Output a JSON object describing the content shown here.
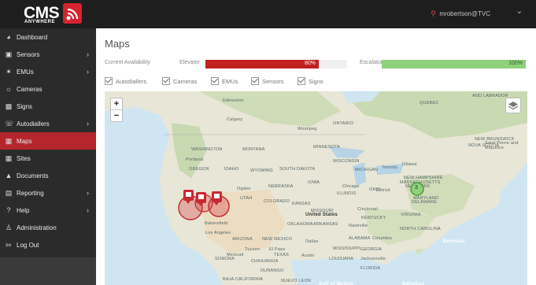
{
  "header": {
    "logo_text": "CMS",
    "logo_subtext": "ANYWHERE",
    "username": "mrobertson@TVC"
  },
  "sidebar": {
    "items": [
      {
        "label": "Dashboard",
        "icon": "dashboard-icon",
        "has_submenu": false
      },
      {
        "label": "Sensors",
        "icon": "sensor-icon",
        "has_submenu": true
      },
      {
        "label": "EMUs",
        "icon": "emu-icon",
        "has_submenu": true
      },
      {
        "label": "Cameras",
        "icon": "camera-icon",
        "has_submenu": false
      },
      {
        "label": "Signs",
        "icon": "sign-icon",
        "has_submenu": false
      },
      {
        "label": "Autodiallers",
        "icon": "autodialler-icon",
        "has_submenu": true
      },
      {
        "label": "Maps",
        "icon": "map-icon",
        "has_submenu": false,
        "active": true
      },
      {
        "label": "Sites",
        "icon": "sites-icon",
        "has_submenu": false
      },
      {
        "label": "Documents",
        "icon": "folder-icon",
        "has_submenu": false
      },
      {
        "label": "Reporting",
        "icon": "reporting-icon",
        "has_submenu": true
      },
      {
        "label": "Help",
        "icon": "help-icon",
        "has_submenu": true
      },
      {
        "label": "Administration",
        "icon": "admin-icon",
        "has_submenu": false
      },
      {
        "label": "Log Out",
        "icon": "logout-icon",
        "has_submenu": false
      }
    ]
  },
  "main": {
    "title": "Maps",
    "availability": {
      "label": "Current Availability",
      "elevator_label": "Elevator",
      "elevator_pct": "80%",
      "elevator_value": 0.8,
      "escalator_label": "Escalator",
      "escalator_pct": "100%",
      "escalator_value": 1.0
    },
    "filters": [
      {
        "label": "Autodiallers",
        "checked": true
      },
      {
        "label": "Cameras",
        "checked": true
      },
      {
        "label": "EMUs",
        "checked": true
      },
      {
        "label": "Sensors",
        "checked": true
      },
      {
        "label": "Signs",
        "checked": true
      }
    ],
    "map": {
      "zoom_in": "+",
      "zoom_out": "−",
      "cluster_count": "3",
      "labels": [
        "Edmonton",
        "Calgary",
        "Winnipeg",
        "ONTARIO",
        "QUEBEC",
        "WASHINGTON",
        "MONTANA",
        "MINNESOTA",
        "Portland",
        "OREGON",
        "IDAHO",
        "WYOMING",
        "SOUTH DAKOTA",
        "WISCONSIN",
        "MICHIGAN",
        "Toronto",
        "Ottawa",
        "NEBRASKA",
        "IOWA",
        "Chicago",
        "OHIO",
        "NEW YORK",
        "Ogden",
        "UTAH",
        "COLORADO",
        "KANSAS",
        "ILLINOIS",
        "Detroit",
        "MISSOURI",
        "Cincinnati",
        "MARYLAND",
        "United States",
        "KENTUCKY",
        "VIRGINIA",
        "Nashville",
        "NORTH CAROLINA",
        "Bakersfield",
        "Los Angeles",
        "ARIZONA",
        "NEW MEXICO",
        "OKLAHOMA",
        "ARKANSAS",
        "ALABAMA",
        "Columbia",
        "Tucson",
        "El Paso",
        "Dallas",
        "MISSISSIPPI",
        "GEORGIA",
        "Austin",
        "LOUISIANA",
        "Jacksonville",
        "FLORIDA",
        "Mexicali",
        "Bermuda",
        "CHIHUAHUA",
        "DURANGO",
        "NUEVO LEON",
        "Gulf of Mexico",
        "Bahamas",
        "BAJA CALIFORNIA",
        "AND LABRADOR",
        "NEW BRUNSWICK",
        "Saint Pierre and Miquelon",
        "NEW HAMPSHIRE",
        "MASSACHUSETTS",
        "NOVA SCOTIA",
        "DELAWARE",
        "SONORA",
        "TEXAS"
      ]
    }
  },
  "colors": {
    "accent": "#b4262c",
    "elevator_bar": "#c0201f",
    "escalator_bar": "#8fd07c",
    "sidebar_bg": "#2b2b2b",
    "topbar_bg": "#1e1e1e"
  }
}
